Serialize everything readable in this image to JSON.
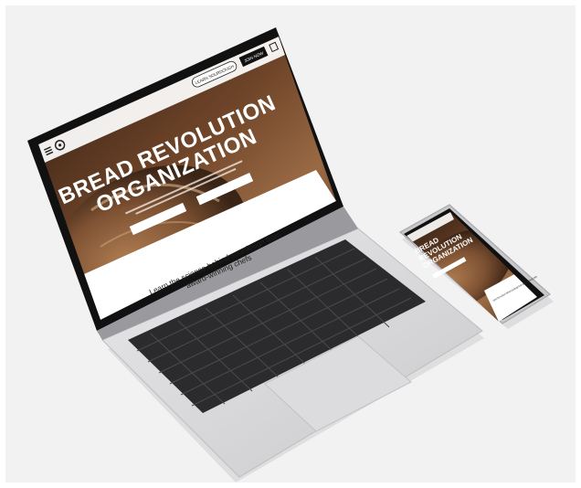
{
  "laptop": {
    "nav": {
      "logo_icon": "sunburst-logo-icon",
      "menu_icon": "hamburger-menu-icon",
      "pill_label": "LEARN SOURDOUGH",
      "cta_label": "JOIN NOW",
      "right_icon": "bag-icon"
    },
    "hero": {
      "title_line1": "BREAD REVOLUTION",
      "title_line2": "ORGANIZATION",
      "subtitle": "",
      "button_left": "",
      "button_right": ""
    },
    "section": {
      "headline_line1": "Learn the science behind sourdough from",
      "headline_line2": "award-winning chefs"
    }
  },
  "phone": {
    "hero": {
      "title_line1": "BREAD",
      "title_line2": "REVOLUTION",
      "title_line3": "ORGANIZATION"
    },
    "section": {
      "headline": "Learn the science behind sourdough from award-winning chefs"
    }
  },
  "colors": {
    "background": "#f2f2f2",
    "device_silver": "#d9d9db",
    "keyboard_black": "#2b2b2d",
    "bread_dark": "#3b2417",
    "bread_mid": "#7a4f32",
    "bread_light": "#a9774f",
    "screen_bezel": "#111111"
  }
}
